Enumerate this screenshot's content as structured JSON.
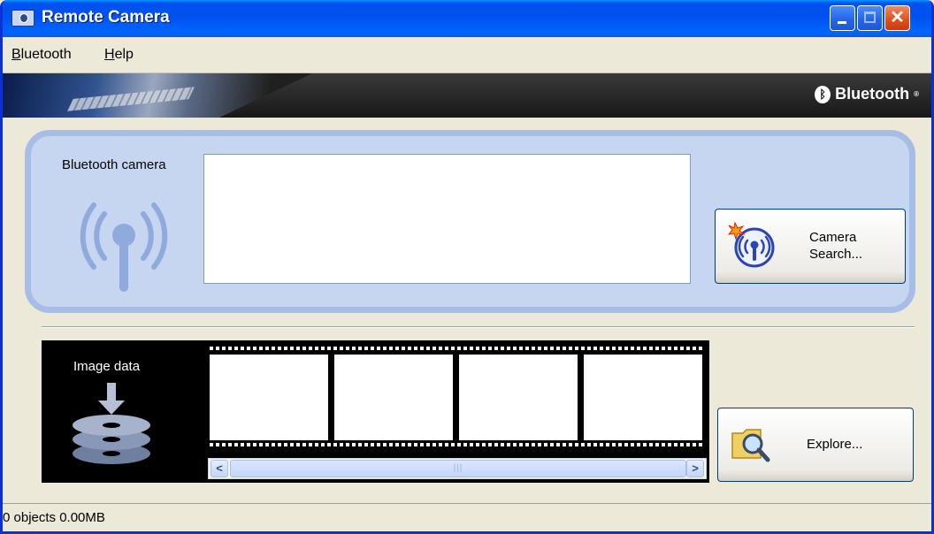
{
  "window": {
    "title": "Remote Camera",
    "accent_color": "#0054e3",
    "close_color": "#e0521e"
  },
  "menu": {
    "items": [
      {
        "label": "Bluetooth",
        "mnemonic": "B",
        "rest": "luetooth"
      },
      {
        "label": "Help",
        "mnemonic": "H",
        "rest": "elp"
      }
    ]
  },
  "banner": {
    "brand": "Bluetooth",
    "brand_mark": "®"
  },
  "camera": {
    "label": "Bluetooth camera",
    "antenna_icon": "bluetooth-antenna-icon",
    "search_button": {
      "line1": "Camera",
      "line2": "Search...",
      "icon": "camera-search-icon"
    }
  },
  "image_data": {
    "label": "Image data",
    "icon": "disk-stack-download-icon",
    "frames": 4,
    "scroll_left": "<",
    "scroll_right": ">",
    "explore_button": {
      "label": "Explore...",
      "icon": "folder-magnifier-icon"
    }
  },
  "status": {
    "text": "0 objects 0.00MB"
  }
}
